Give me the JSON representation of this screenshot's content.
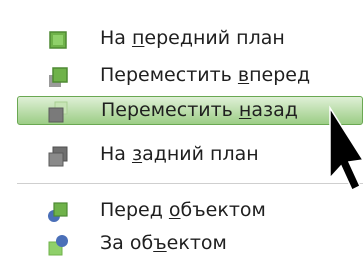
{
  "menu": {
    "items": [
      {
        "pre": "На ",
        "u": "п",
        "post": "ередний план",
        "icon": "bring-to-front-icon"
      },
      {
        "pre": "Переместить ",
        "u": "в",
        "post": "перед",
        "icon": "bring-forward-icon"
      },
      {
        "pre": "Переместить ",
        "u": "н",
        "post": "азад",
        "icon": "send-backward-icon",
        "selected": true
      },
      {
        "pre": "На ",
        "u": "з",
        "post": "адний план",
        "icon": "send-to-back-icon"
      },
      {
        "pre": "Перед ",
        "u": "о",
        "post": "бъектом",
        "icon": "in-front-of-object-icon"
      },
      {
        "pre": "За об",
        "u": "ъ",
        "post": "ектом",
        "icon": "behind-object-icon"
      }
    ]
  },
  "colors": {
    "icon_green": "#6fb24a",
    "icon_gray": "#808080",
    "icon_blue": "#4a6fb8",
    "selection": "#9ccd86"
  },
  "cursor": {
    "icon": "mouse-pointer-icon"
  }
}
